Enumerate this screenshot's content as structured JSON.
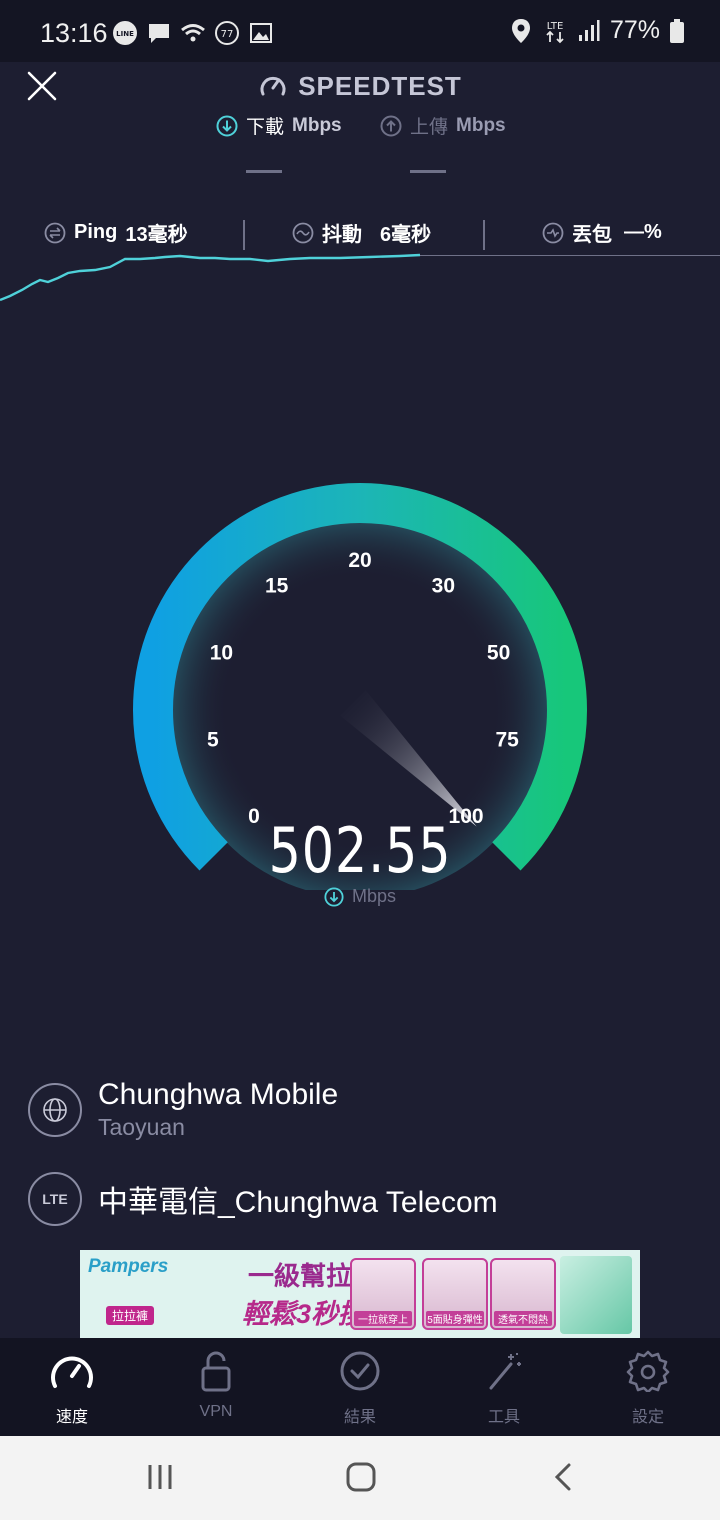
{
  "status_bar": {
    "time": "13:16",
    "left_icons": [
      "line-icon",
      "message-icon",
      "wifi-icon",
      "notification-count-icon",
      "gallery-icon"
    ],
    "notification_count": "77",
    "network": "LTE",
    "battery": "77%"
  },
  "header": {
    "title": "SPEEDTEST",
    "download_label": "下載",
    "download_unit": "Mbps",
    "upload_label": "上傳",
    "upload_unit": "Mbps",
    "download_value": "—",
    "upload_value": "—"
  },
  "stats": {
    "ping_label": "Ping",
    "ping_value": "13毫秒",
    "jitter_label": "抖動",
    "jitter_value": "6毫秒",
    "loss_label": "丟包",
    "loss_value": "—%"
  },
  "gauge": {
    "ticks": [
      "0",
      "5",
      "10",
      "15",
      "20",
      "30",
      "50",
      "75",
      "100"
    ],
    "reading": "502.55",
    "unit": "Mbps",
    "colors": {
      "start": "#0fa0e3",
      "mid": "#1cb5b7",
      "end": "#17c77a"
    }
  },
  "server": {
    "provider": "Chunghwa Mobile",
    "location": "Taoyuan"
  },
  "connection": {
    "badge": "LTE",
    "carrier": "中華電信_Chunghwa Telecom"
  },
  "ad": {
    "brand": "Pampers",
    "brand_sub": "拉拉褲",
    "headline": "一級幫拉拉褲",
    "subheadline": "輕鬆3秒換穿!",
    "captions": [
      "一拉就穿上",
      "5面貼身彈性",
      "透氣不悶熱"
    ]
  },
  "tabs": [
    {
      "label": "速度",
      "icon": "speedometer-icon",
      "active": true
    },
    {
      "label": "VPN",
      "icon": "lock-icon",
      "active": false
    },
    {
      "label": "結果",
      "icon": "check-circle-icon",
      "active": false
    },
    {
      "label": "工具",
      "icon": "wand-icon",
      "active": false
    },
    {
      "label": "設定",
      "icon": "gear-icon",
      "active": false
    }
  ],
  "nav": [
    "recents-icon",
    "home-icon",
    "back-icon"
  ],
  "accent_color": "#4fd1d9"
}
